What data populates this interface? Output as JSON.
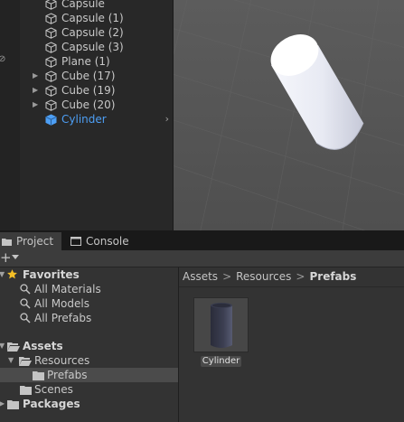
{
  "hierarchy": {
    "items": [
      {
        "label": "Capsule",
        "expandable": false,
        "selected": false
      },
      {
        "label": "Capsule (1)",
        "expandable": false,
        "selected": false
      },
      {
        "label": "Capsule (2)",
        "expandable": false,
        "selected": false
      },
      {
        "label": "Capsule (3)",
        "expandable": false,
        "selected": false
      },
      {
        "label": "Plane (1)",
        "expandable": false,
        "selected": false
      },
      {
        "label": "Cube (17)",
        "expandable": true,
        "selected": false
      },
      {
        "label": "Cube (19)",
        "expandable": true,
        "selected": false
      },
      {
        "label": "Cube (20)",
        "expandable": true,
        "selected": false
      },
      {
        "label": "Cylinder",
        "expandable": false,
        "selected": true
      }
    ],
    "gutter_glyph": "⊘",
    "selected_color": "#4d9ff5"
  },
  "tabs": [
    {
      "label": "Project",
      "icon": "folder-icon",
      "active": true
    },
    {
      "label": "Console",
      "icon": "console-icon",
      "active": false
    }
  ],
  "toolbar": {
    "add": "+"
  },
  "project_tree": {
    "favorites": {
      "label": "Favorites",
      "items": [
        "All Materials",
        "All Models",
        "All Prefabs"
      ]
    },
    "assets": {
      "label": "Assets",
      "resources": "Resources",
      "prefabs": "Prefabs",
      "scenes": "Scenes"
    },
    "packages": "Packages"
  },
  "breadcrumb": {
    "items": [
      "Assets",
      "Resources",
      "Prefabs"
    ],
    "separator": ">"
  },
  "assets": [
    {
      "name": "Cylinder",
      "type": "prefab"
    }
  ]
}
